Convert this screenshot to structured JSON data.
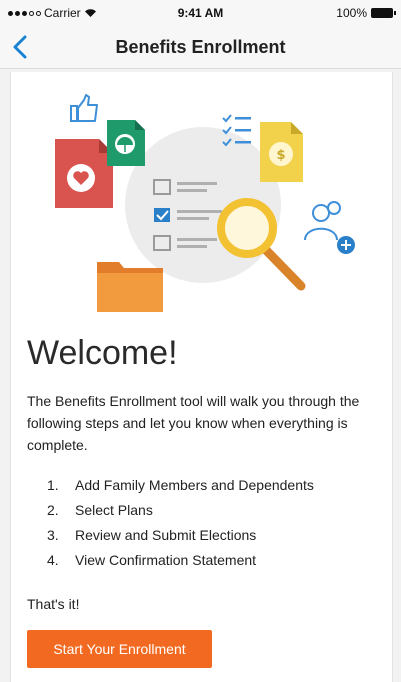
{
  "status": {
    "carrier": "Carrier",
    "time": "9:41 AM",
    "battery": "100%"
  },
  "nav": {
    "title": "Benefits Enrollment",
    "back_icon": "chevron-left-icon"
  },
  "hero": {
    "icons": [
      "thumbs-up-icon",
      "heart-document-icon",
      "umbrella-document-icon",
      "checklist-icon",
      "dollar-document-icon",
      "magnifier-icon",
      "add-user-icon",
      "folder-icon"
    ]
  },
  "main": {
    "heading": "Welcome!",
    "intro": "The Benefits Enrollment tool will walk you through the following steps and let you know when everything is complete.",
    "steps": [
      {
        "num": "1.",
        "label": "Add Family Members and Dependents"
      },
      {
        "num": "2.",
        "label": "Select Plans"
      },
      {
        "num": "3.",
        "label": "Review and Submit Elections"
      },
      {
        "num": "4.",
        "label": "View Confirmation Statement"
      }
    ],
    "closing": "That's it!",
    "start_button": "Start Your Enrollment"
  },
  "colors": {
    "accent": "#f26a21",
    "link": "#1a82d1"
  }
}
